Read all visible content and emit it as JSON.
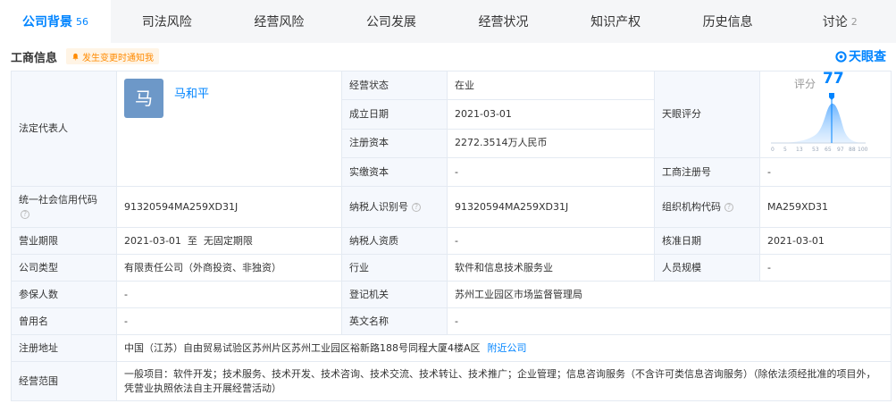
{
  "tabs": [
    {
      "label": "公司背景",
      "count": "56"
    },
    {
      "label": "司法风险"
    },
    {
      "label": "经营风险"
    },
    {
      "label": "公司发展"
    },
    {
      "label": "经营状况"
    },
    {
      "label": "知识产权"
    },
    {
      "label": "历史信息"
    },
    {
      "label": "讨论",
      "count": "2"
    }
  ],
  "section": {
    "title": "工商信息",
    "notify": "发生变更时通知我",
    "brand": "天眼查"
  },
  "legal_rep": {
    "label": "法定代表人",
    "avatar_char": "马",
    "name": "马和平"
  },
  "status": {
    "label": "经营状态",
    "value": "在业"
  },
  "founded": {
    "label": "成立日期",
    "value": "2021-03-01"
  },
  "reg_capital": {
    "label": "注册资本",
    "value": "2272.3514万人民币"
  },
  "paid_capital": {
    "label": "实缴资本",
    "value": "-"
  },
  "score": {
    "label": "天眼评分",
    "score_label": "评分",
    "value": "77",
    "ticks": [
      "0",
      "5",
      "13",
      "53",
      "65",
      "97",
      "88",
      "100"
    ],
    "accent": "#0084ff"
  },
  "biz_reg_no": {
    "label": "工商注册号",
    "value": "-"
  },
  "credit_code": {
    "label": "统一社会信用代码",
    "value": "91320594MA259XD31J"
  },
  "taxpayer_id": {
    "label": "纳税人识别号",
    "value": "91320594MA259XD31J"
  },
  "org_code": {
    "label": "组织机构代码",
    "value": "MA259XD31"
  },
  "term": {
    "label": "营业期限",
    "value": "2021-03-01  至  无固定期限"
  },
  "taxpayer_qual": {
    "label": "纳税人资质",
    "value": "-"
  },
  "approval_date": {
    "label": "核准日期",
    "value": "2021-03-01"
  },
  "company_type": {
    "label": "公司类型",
    "value": "有限责任公司（外商投资、非独资）"
  },
  "industry": {
    "label": "行业",
    "value": "软件和信息技术服务业"
  },
  "staff_size": {
    "label": "人员规模",
    "value": "-"
  },
  "insured": {
    "label": "参保人数",
    "value": "-"
  },
  "reg_authority": {
    "label": "登记机关",
    "value": "苏州工业园区市场监督管理局"
  },
  "former_name": {
    "label": "曾用名",
    "value": "-"
  },
  "english_name": {
    "label": "英文名称",
    "value": "-"
  },
  "address": {
    "label": "注册地址",
    "value": "中国（江苏）自由贸易试验区苏州片区苏州工业园区裕新路188号同程大厦4楼A区",
    "link": "附近公司"
  },
  "scope": {
    "label": "经营范围",
    "value": "一般项目：软件开发；技术服务、技术开发、技术咨询、技术交流、技术转让、技术推广；企业管理；信息咨询服务（不含许可类信息咨询服务）（除依法须经批准的项目外，凭营业执照依法自主开展经营活动）"
  }
}
